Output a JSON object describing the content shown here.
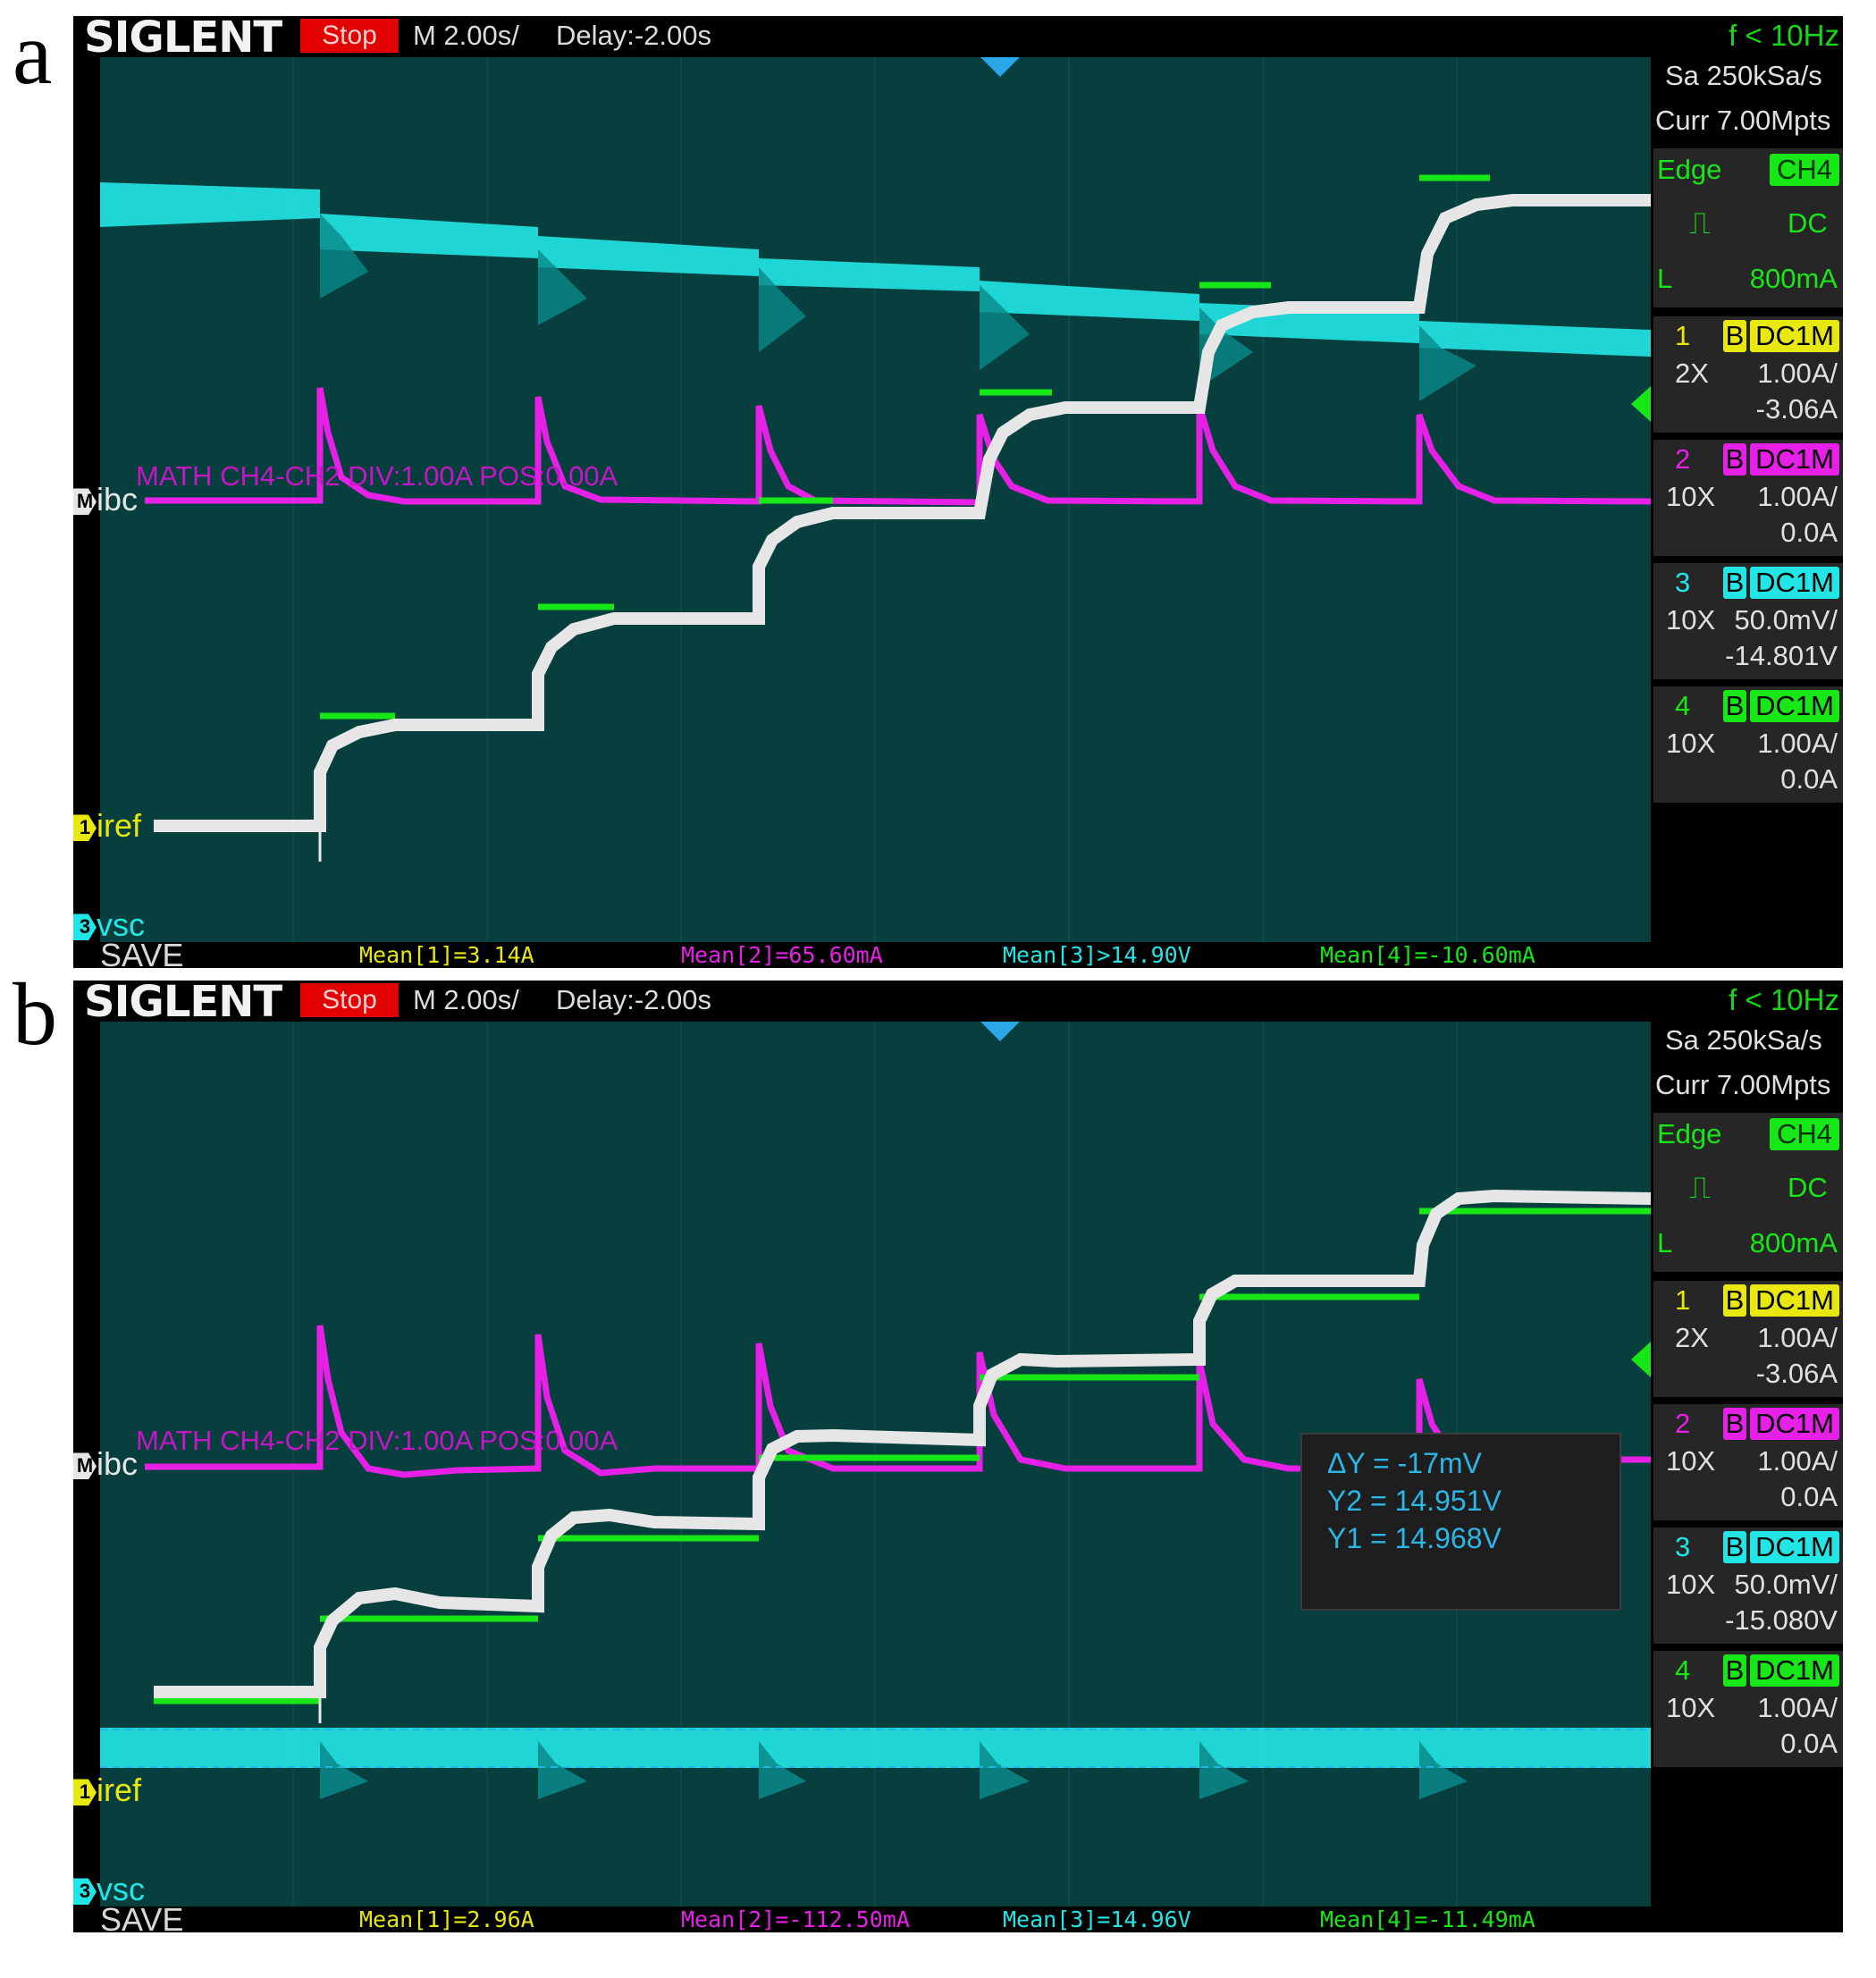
{
  "colors": {
    "ch1": "#e8e80f",
    "ch2": "#e620e6",
    "ch3": "#22e6e6",
    "ch4": "#17e617",
    "trace_ch1": "#e6e6e6",
    "math": "#c416c4",
    "background": "#073f3f",
    "stop": "#e30000"
  },
  "panels": [
    {
      "label": "a",
      "header": {
        "brand": "SIGLENT",
        "status": "Stop",
        "timebase": "M 2.00s/",
        "delay": "Delay:-2.00s",
        "freq": "f < 10Hz"
      },
      "sidebar": {
        "sample_rate": "Sa 250kSa/s",
        "memory": "Curr 7.00Mpts",
        "trigger": {
          "type": "Edge",
          "source": "CH4",
          "coupling": "DC",
          "level_prefix": "L",
          "level": "800mA"
        },
        "channels": [
          {
            "num": "1",
            "bw": "B",
            "coupling": "DC1M",
            "probe": "2X",
            "scale": "1.00A/",
            "offset": "-3.06A"
          },
          {
            "num": "2",
            "bw": "B",
            "coupling": "DC1M",
            "probe": "10X",
            "scale": "1.00A/",
            "offset": "0.0A"
          },
          {
            "num": "3",
            "bw": "B",
            "coupling": "DC1M",
            "probe": "10X",
            "scale": "50.0mV/",
            "offset": "-14.801V"
          },
          {
            "num": "4",
            "bw": "B",
            "coupling": "DC1M",
            "probe": "10X",
            "scale": "1.00A/",
            "offset": "0.0A"
          }
        ]
      },
      "math_label": "MATH  CH4-CH2  DIV:1.00A  POS:0.00A",
      "markers": {
        "math": "ibc",
        "math_icon": "M",
        "ch1": "iref",
        "ch1_icon": "1",
        "ch3": "vsc",
        "ch3_icon": "3"
      },
      "bottom": {
        "save": "SAVE",
        "mean1": "Mean[1]=3.14A",
        "mean2": "Mean[2]=65.60mA",
        "mean3": "Mean[3]>14.90V",
        "mean4": "Mean[4]=-10.60mA"
      }
    },
    {
      "label": "b",
      "header": {
        "brand": "SIGLENT",
        "status": "Stop",
        "timebase": "M 2.00s/",
        "delay": "Delay:-2.00s",
        "freq": "f < 10Hz"
      },
      "sidebar": {
        "sample_rate": "Sa 250kSa/s",
        "memory": "Curr 7.00Mpts",
        "trigger": {
          "type": "Edge",
          "source": "CH4",
          "coupling": "DC",
          "level_prefix": "L",
          "level": "800mA"
        },
        "channels": [
          {
            "num": "1",
            "bw": "B",
            "coupling": "DC1M",
            "probe": "2X",
            "scale": "1.00A/",
            "offset": "-3.06A"
          },
          {
            "num": "2",
            "bw": "B",
            "coupling": "DC1M",
            "probe": "10X",
            "scale": "1.00A/",
            "offset": "0.0A"
          },
          {
            "num": "3",
            "bw": "B",
            "coupling": "DC1M",
            "probe": "10X",
            "scale": "50.0mV/",
            "offset": "-15.080V"
          },
          {
            "num": "4",
            "bw": "B",
            "coupling": "DC1M",
            "probe": "10X",
            "scale": "1.00A/",
            "offset": "0.0A"
          }
        ]
      },
      "math_label": "MATH  CH4-CH2  DIV:1.00A  POS:0.00A",
      "markers": {
        "math": "ibc",
        "math_icon": "M",
        "ch1": "iref",
        "ch1_icon": "1",
        "ch3": "vsc",
        "ch3_icon": "3"
      },
      "cursor": {
        "dy": "ΔY = -17mV",
        "y2": "Y2 = 14.951V",
        "y1": "Y1 = 14.968V"
      },
      "bottom": {
        "save": "SAVE",
        "mean1": "Mean[1]=2.96A",
        "mean2": "Mean[2]=-112.50mA",
        "mean3": "Mean[3]=14.96V",
        "mean4": "Mean[4]=-11.49mA"
      }
    }
  ]
}
